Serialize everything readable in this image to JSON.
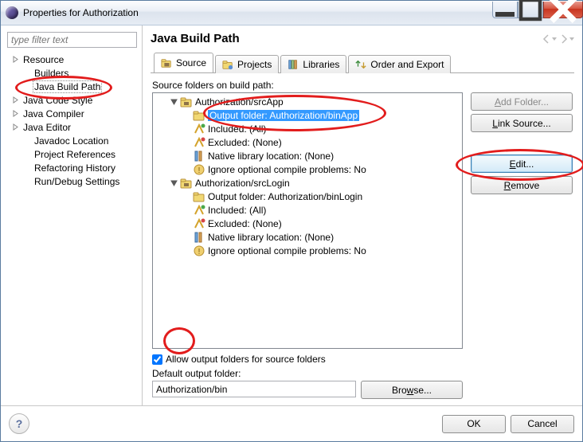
{
  "window": {
    "title": "Properties for Authorization"
  },
  "filter": {
    "placeholder": "type filter text"
  },
  "left_tree": [
    {
      "label": "Resource",
      "level": 1,
      "expandable": true,
      "selected": false
    },
    {
      "label": "Builders",
      "level": 2,
      "expandable": false,
      "selected": false
    },
    {
      "label": "Java Build Path",
      "level": 2,
      "expandable": false,
      "selected": true
    },
    {
      "label": "Java Code Style",
      "level": 1,
      "expandable": true,
      "selected": false
    },
    {
      "label": "Java Compiler",
      "level": 1,
      "expandable": true,
      "selected": false
    },
    {
      "label": "Java Editor",
      "level": 1,
      "expandable": true,
      "selected": false
    },
    {
      "label": "Javadoc Location",
      "level": 2,
      "expandable": false,
      "selected": false
    },
    {
      "label": "Project References",
      "level": 2,
      "expandable": false,
      "selected": false
    },
    {
      "label": "Refactoring History",
      "level": 2,
      "expandable": false,
      "selected": false
    },
    {
      "label": "Run/Debug Settings",
      "level": 2,
      "expandable": false,
      "selected": false
    }
  ],
  "header": {
    "title": "Java Build Path"
  },
  "tabs": {
    "source": "Source",
    "projects": "Projects",
    "libraries": "Libraries",
    "order": "Order and Export"
  },
  "source_panel": {
    "label": "Source folders on build path:",
    "rows": [
      {
        "lvl": "b",
        "icon": "pkg",
        "text": "Authorization/srcApp",
        "exp": "open"
      },
      {
        "lvl": "c",
        "icon": "fld",
        "text": "Output folder: Authorization/binApp",
        "sel": true
      },
      {
        "lvl": "c",
        "icon": "inc",
        "text": "Included: (All)"
      },
      {
        "lvl": "c",
        "icon": "exc",
        "text": "Excluded: (None)"
      },
      {
        "lvl": "c",
        "icon": "lib",
        "text": "Native library location: (None)"
      },
      {
        "lvl": "c",
        "icon": "ign",
        "text": "Ignore optional compile problems: No"
      },
      {
        "lvl": "b",
        "icon": "pkg",
        "text": "Authorization/srcLogin",
        "exp": "open"
      },
      {
        "lvl": "c",
        "icon": "fld",
        "text": "Output folder: Authorization/binLogin"
      },
      {
        "lvl": "c",
        "icon": "inc",
        "text": "Included: (All)"
      },
      {
        "lvl": "c",
        "icon": "exc",
        "text": "Excluded: (None)"
      },
      {
        "lvl": "c",
        "icon": "lib",
        "text": "Native library location: (None)"
      },
      {
        "lvl": "c",
        "icon": "ign",
        "text": "Ignore optional compile problems: No"
      }
    ]
  },
  "buttons": {
    "add_folder": "Add Folder...",
    "link_source": "Link Source...",
    "edit": "Edit...",
    "remove": "Remove",
    "browse": "Browse...",
    "ok": "OK",
    "cancel": "Cancel"
  },
  "allow_output": {
    "label": "Allow output folders for source folders",
    "checked": true
  },
  "default_output": {
    "label": "Default output folder:",
    "value": "Authorization/bin"
  }
}
